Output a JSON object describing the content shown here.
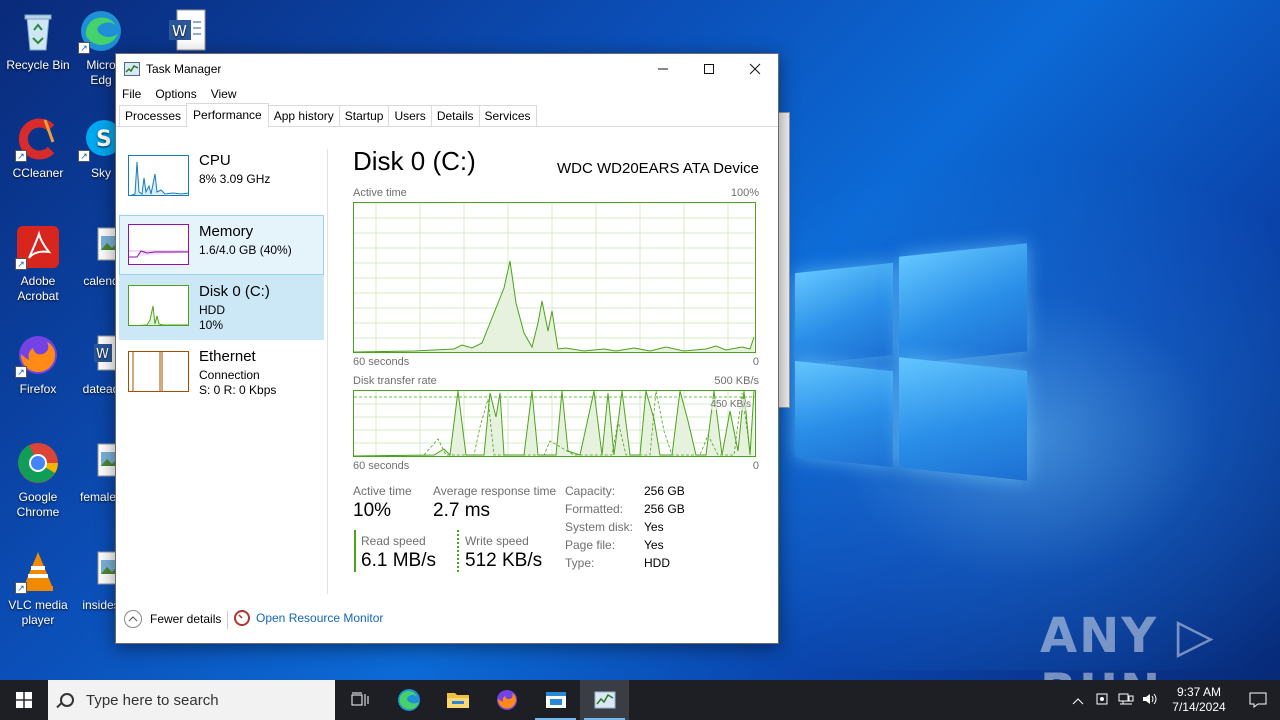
{
  "desktop": {
    "icons": [
      {
        "label": "Recycle Bin",
        "icon": "recycle-bin-icon"
      },
      {
        "label": "Micro Edg",
        "icon": "edge-icon"
      },
      {
        "label": "",
        "icon": "word-doc-icon"
      },
      {
        "label": "CCleaner",
        "icon": "ccleaner-icon"
      },
      {
        "label": "Sky",
        "icon": "skype-icon"
      },
      {
        "label": "Adobe Acrobat",
        "icon": "acrobat-icon"
      },
      {
        "label": "calend",
        "icon": "image-file-icon"
      },
      {
        "label": "Firefox",
        "icon": "firefox-icon"
      },
      {
        "label": "datead",
        "icon": "word-doc-icon"
      },
      {
        "label": "Google Chrome",
        "icon": "chrome-icon"
      },
      {
        "label": "femalev",
        "icon": "image-file-icon"
      },
      {
        "label": "VLC media player",
        "icon": "vlc-icon"
      },
      {
        "label": "insides",
        "icon": "image-file-icon"
      }
    ],
    "watermark": "ANY ▷ RUN"
  },
  "task_manager": {
    "title": "Task Manager",
    "menu": [
      "File",
      "Options",
      "View"
    ],
    "tabs": [
      "Processes",
      "Performance",
      "App history",
      "Startup",
      "Users",
      "Details",
      "Services"
    ],
    "active_tab": "Performance",
    "sidebar": [
      {
        "title": "CPU",
        "sub1": "8% 3.09 GHz",
        "sub2": ""
      },
      {
        "title": "Memory",
        "sub1": "1.6/4.0 GB (40%)",
        "sub2": ""
      },
      {
        "title": "Disk 0 (C:)",
        "sub1": "HDD",
        "sub2": "10%"
      },
      {
        "title": "Ethernet",
        "sub1": "Connection",
        "sub2": "S: 0 R: 0 Kbps"
      }
    ],
    "main": {
      "title": "Disk 0 (C:)",
      "device": "WDC WD20EARS ATA Device",
      "graph1": {
        "label": "Active time",
        "max": "100%",
        "time": "60 seconds",
        "min": "0"
      },
      "graph2": {
        "label": "Disk transfer rate",
        "max": "500 KB/s",
        "marker": "450 KB/s",
        "time": "60 seconds",
        "min": "0"
      },
      "stats": {
        "active_time_label": "Active time",
        "active_time": "10%",
        "avg_resp_label": "Average response time",
        "avg_resp": "2.7 ms",
        "read_label": "Read speed",
        "read": "6.1 MB/s",
        "write_label": "Write speed",
        "write": "512 KB/s"
      },
      "props": [
        {
          "k": "Capacity:",
          "v": "256 GB"
        },
        {
          "k": "Formatted:",
          "v": "256 GB"
        },
        {
          "k": "System disk:",
          "v": "Yes"
        },
        {
          "k": "Page file:",
          "v": "Yes"
        },
        {
          "k": "Type:",
          "v": "HDD"
        }
      ]
    },
    "footer": {
      "fewer": "Fewer details",
      "monitor": "Open Resource Monitor"
    }
  },
  "taskbar": {
    "search_placeholder": "Type here to search",
    "time": "9:37 AM",
    "date": "7/14/2024"
  },
  "colors": {
    "disk_green": "#4da21b",
    "cpu_blue": "#117dbb",
    "memory_purple": "#8b12ae",
    "ethernet_orange": "#a74f01"
  }
}
